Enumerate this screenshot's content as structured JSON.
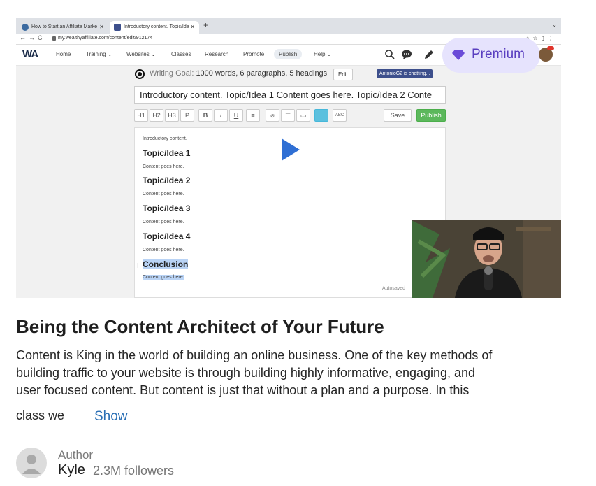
{
  "browser": {
    "tabs": [
      {
        "title": "How to Start an Affiliate Marke",
        "active": false
      },
      {
        "title": "Introductory content. Topic/Ide",
        "active": true
      }
    ],
    "new_tab": "+",
    "url": "my.wealthyaffiliate.com/content/edit/912174"
  },
  "site_nav": {
    "logo": "WA",
    "items": [
      "Home",
      "Training ⌄",
      "Websites ⌄",
      "Classes",
      "Research",
      "Promote",
      "Publish",
      "Help ⌄"
    ],
    "premium_label": "Premium",
    "notification_count": "19"
  },
  "editor": {
    "goal_label": "Writing Goal:",
    "goal_value": "1000 words, 6 paragraphs, 5 headings",
    "goal_edit": "Edit",
    "chat_notice": "AntonioG2 is chatting...",
    "title_value": "Introductory content. Topic/Idea 1 Content goes here. Topic/Idea 2 Conte",
    "toolbar": {
      "h1": "H1",
      "h2": "H2",
      "h3": "H3",
      "p": "P",
      "b": "B",
      "i": "i",
      "u": "U",
      "save": "Save",
      "publish": "Publish"
    },
    "body": {
      "intro": "Introductory content.",
      "h1": "Topic/Idea 1",
      "c1": "Content goes here.",
      "h2": "Topic/Idea 2",
      "c2": "Content goes here.",
      "h3": "Topic/Idea 3",
      "c3": "Content goes here.",
      "h4": "Topic/Idea 4",
      "c4": "Content goes here.",
      "h5": "Conclusion",
      "c5": "Content goes here."
    },
    "autosaved": "Autosaved"
  },
  "video": {
    "title": "Being the Content Architect of Your Future",
    "description_lines": [
      "Content is King in the world of building an online business. One of the key methods of",
      "building traffic to your website is through building highly informative, engaging, and",
      "user focused content. But content is just that without a plan and a purpose. In this"
    ],
    "description_last": "class we",
    "show_label": "Show"
  },
  "author": {
    "label": "Author",
    "name": "Kyle",
    "followers": "2.3M followers"
  },
  "colors": {
    "premium_bg": "#e6e3fd",
    "premium_text": "#5a3fc0",
    "play": "#2f6fd4",
    "link": "#2a6fb5",
    "publish_green": "#5cb85c"
  }
}
